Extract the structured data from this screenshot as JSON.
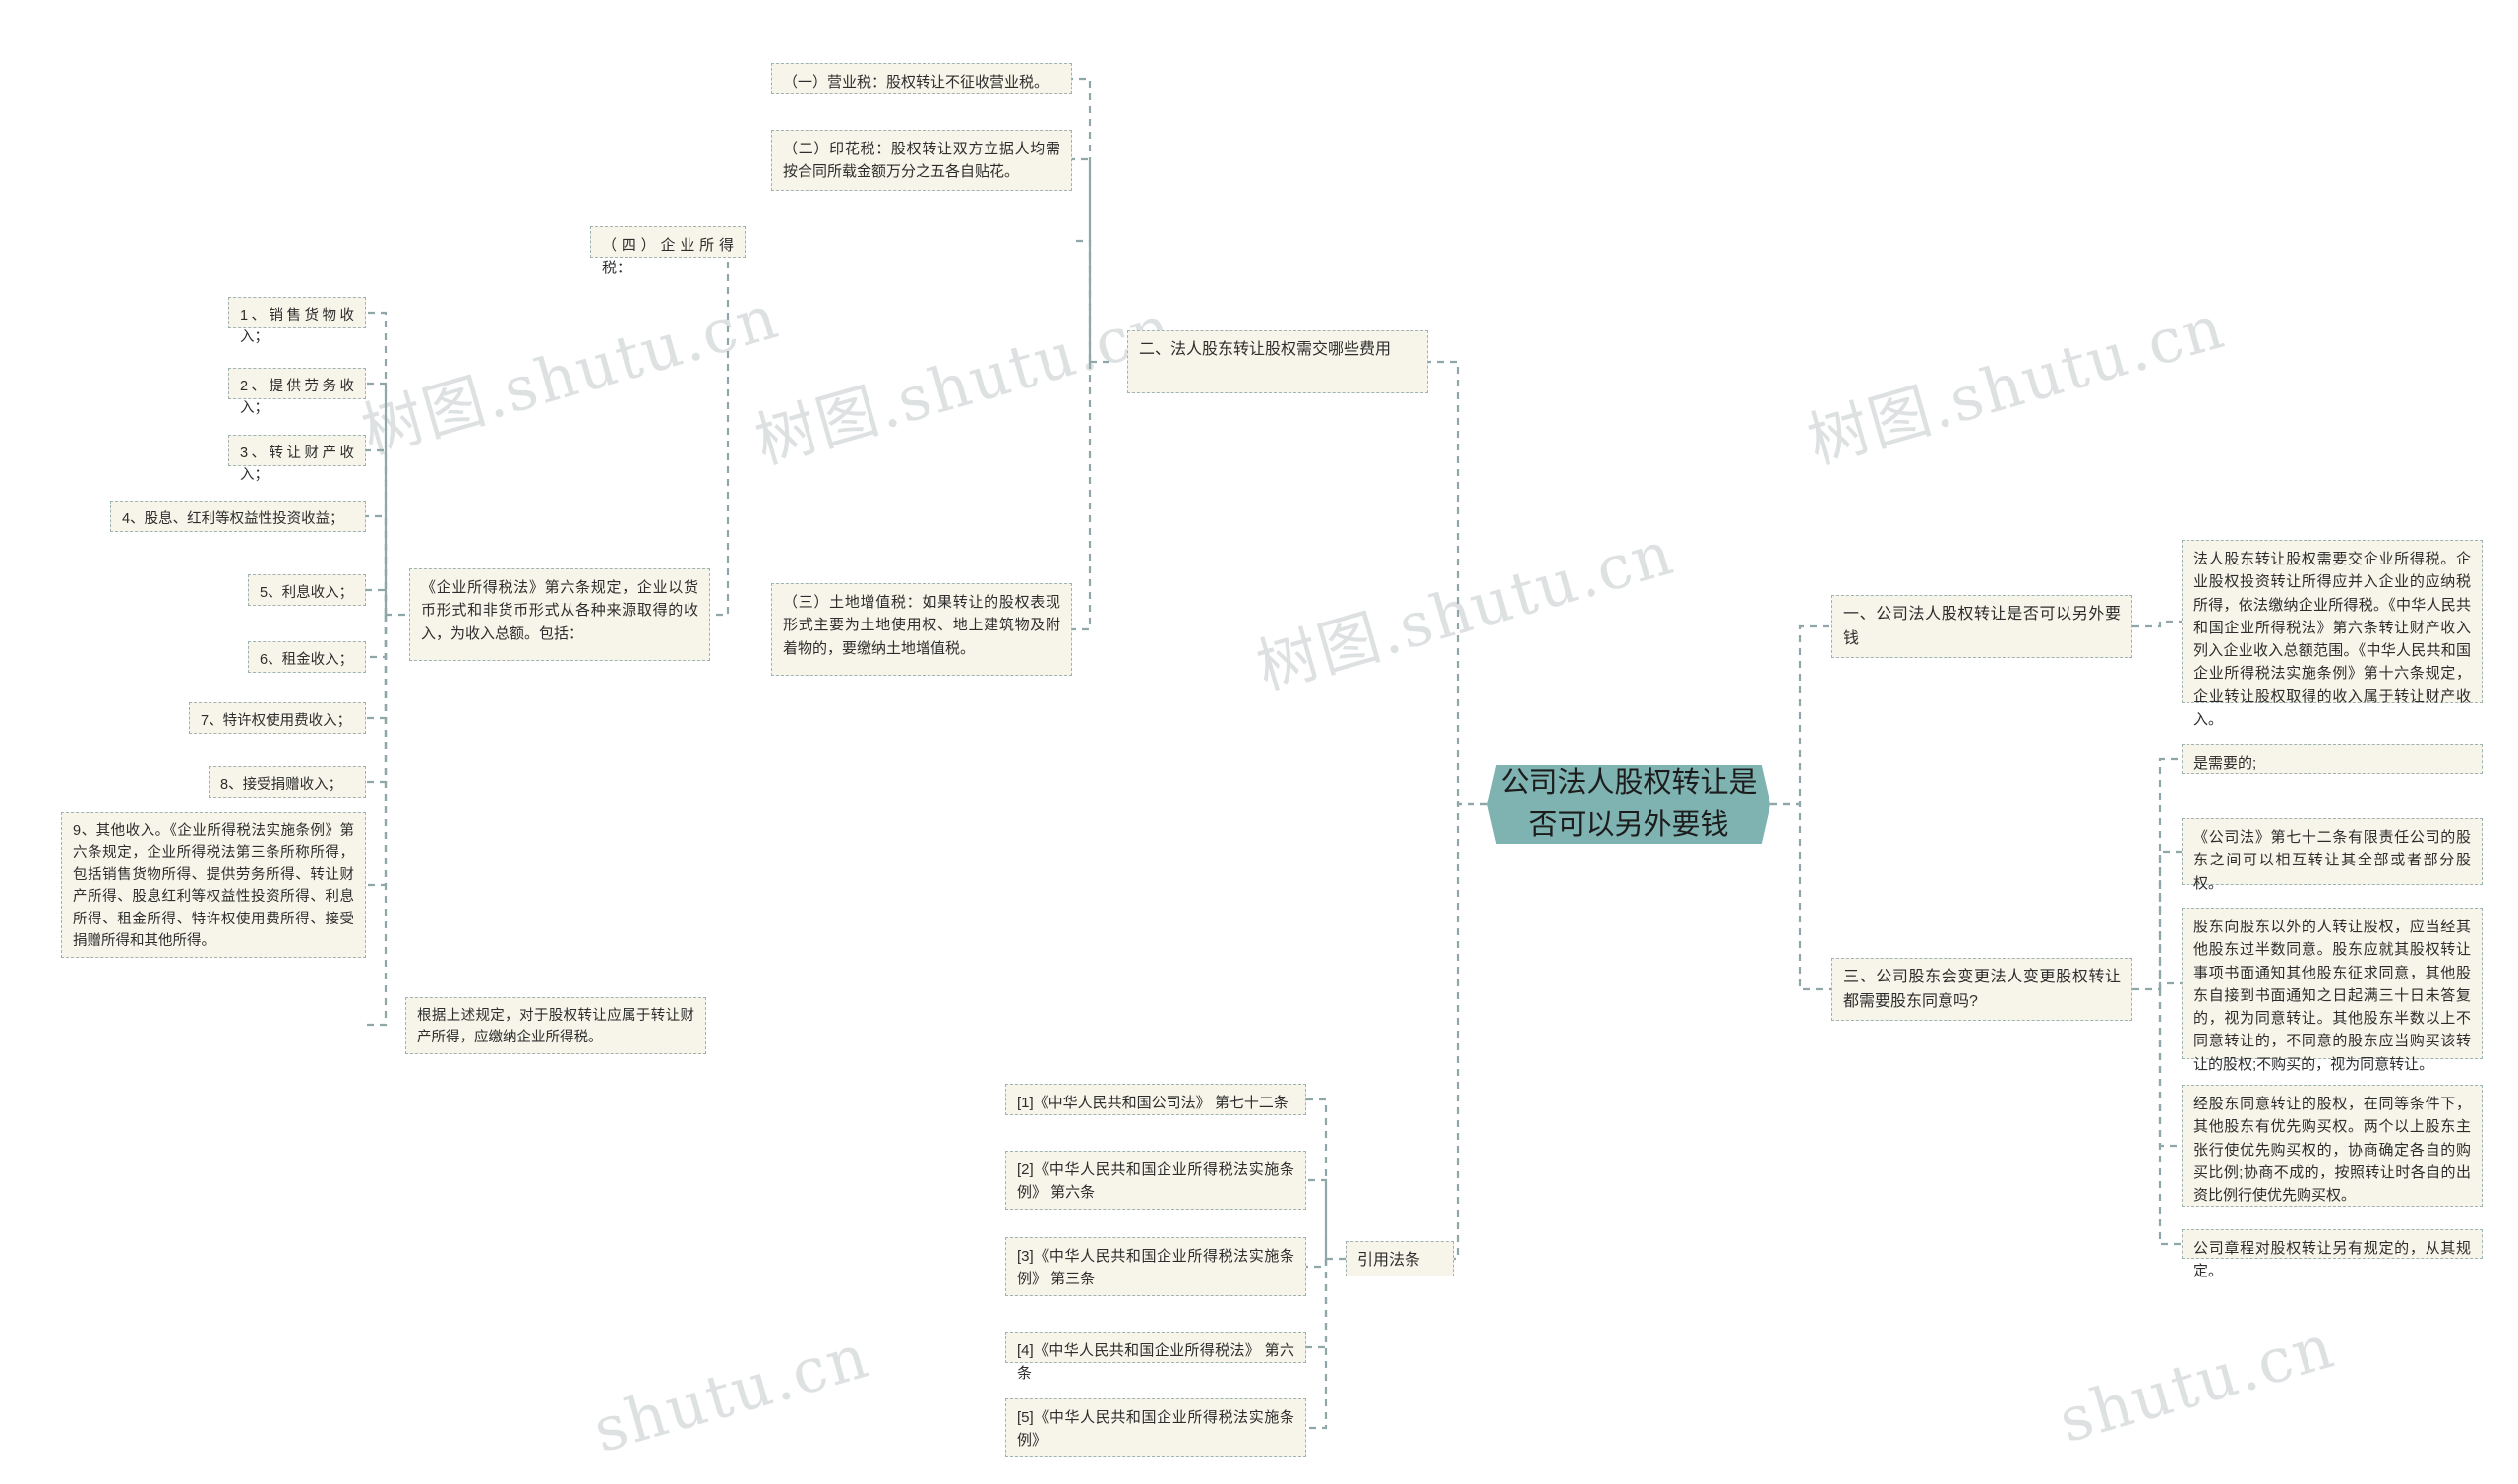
{
  "meta": {
    "accent_teal": "#7fb3b2",
    "node_fill": "#f7f5e9",
    "node_border": "#9fb3b3",
    "link_color": "#8fa7a8"
  },
  "watermarks": [
    "树图.shutu.cn",
    "树图.shutu.cn",
    "树图.shutu.cn",
    "树图.shutu.cn",
    "shutu.cn",
    "shutu.cn"
  ],
  "center": {
    "label": "公司法人股权转让是否可以另外要钱"
  },
  "branches": {
    "fees": {
      "label": "二、法人股东转让股权需交哪些费用",
      "items": {
        "business_tax": "（一）营业税：股权转让不征收营业税。",
        "stamp_tax": "（二）印花税：股权转让双方立据人均需按合同所载金额万分之五各自贴花。",
        "corporate_tax_label": "（四）企业所得税：",
        "land_vat": "（三）土地增值税：如果转让的股权表现形式主要为土地使用权、地上建筑物及附着物的，要缴纳土地增值税。"
      },
      "corporate_tax": {
        "intro": "《企业所得税法》第六条规定，企业以货币形式和非货币形式从各种来源取得的收入，为收入总额。包括：",
        "income_items": [
          "1、销售货物收入；",
          "2、提供劳务收入；",
          "3、转让财产收入；",
          "4、股息、红利等权益性投资收益；",
          "5、利息收入；",
          "6、租金收入；",
          "7、特许权使用费收入；",
          "8、接受捐赠收入；",
          "9、其他收入。《企业所得税法实施条例》第六条规定，企业所得税法第三条所称所得，包括销售货物所得、提供劳务所得、转让财产所得、股息红利等权益性投资所得、利息所得、租金所得、特许权使用费所得、接受捐赠所得和其他所得。"
        ],
        "conclusion": "根据上述规定，对于股权转让应属于转让财产所得，应缴纳企业所得税。"
      }
    },
    "extra_money": {
      "label": "一、公司法人股权转让是否可以另外要钱",
      "detail": "法人股东转让股权需要交企业所得税。企业股权投资转让所得应并入企业的应纳税所得，依法缴纳企业所得税。《中华人民共和国企业所得税法》第六条转让财产收入列入企业收入总额范围。《中华人民共和国企业所得税法实施条例》第十六条规定，企业转让股权取得的收入属于转让财产收入。"
    },
    "shareholder_consent": {
      "label": "三、公司股东会变更法人变更股权转让都需要股东同意吗?",
      "details": [
        "是需要的;",
        "《公司法》第七十二条有限责任公司的股东之间可以相互转让其全部或者部分股权。",
        "股东向股东以外的人转让股权，应当经其他股东过半数同意。股东应就其股权转让事项书面通知其他股东征求同意，其他股东自接到书面通知之日起满三十日未答复的，视为同意转让。其他股东半数以上不同意转让的，不同意的股东应当购买该转让的股权;不购买的，视为同意转让。",
        "经股东同意转让的股权，在同等条件下，其他股东有优先购买权。两个以上股东主张行使优先购买权的，协商确定各自的购买比例;协商不成的，按照转让时各自的出资比例行使优先购买权。",
        "公司章程对股权转让另有规定的，从其规定。"
      ]
    },
    "citations": {
      "label": "引用法条",
      "items": [
        "[1]《中华人民共和国公司法》 第七十二条",
        "[2]《中华人民共和国企业所得税法实施条例》 第六条",
        "[3]《中华人民共和国企业所得税法实施条例》 第三条",
        "[4]《中华人民共和国企业所得税法》 第六条",
        "[5]《中华人民共和国企业所得税法实施条例》"
      ]
    }
  }
}
